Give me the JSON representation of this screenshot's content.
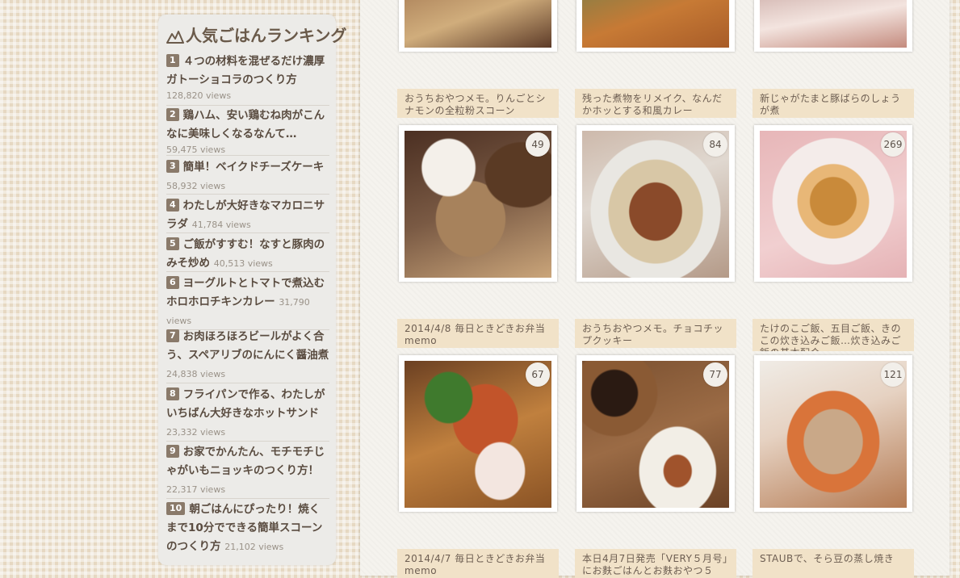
{
  "sidebar": {
    "ranking_title": "人気ごはんランキング",
    "items": [
      {
        "rank": "1",
        "title": "４つの材料を混ぜるだけ濃厚ガトーショコラのつくり方",
        "views": "128,820 views"
      },
      {
        "rank": "2",
        "title": "鶏ハム、安い鶏むね肉がこんなに美味しくなるなんて…",
        "views": "59,475 views"
      },
      {
        "rank": "3",
        "title": "簡単！ベイクドチーズケーキ",
        "views": "58,932 views"
      },
      {
        "rank": "4",
        "title": "わたしが大好きなマカロニサラダ",
        "views": "41,784 views"
      },
      {
        "rank": "5",
        "title": "ご飯がすすむ！なすと豚肉のみそ炒め",
        "views": "40,513 views"
      },
      {
        "rank": "6",
        "title": "ヨーグルトとトマトで煮込むホロホロチキンカレー",
        "views": "31,790 views"
      },
      {
        "rank": "7",
        "title": "お肉ほろほろビールがよく合う、スペアリブのにんにく醤油煮",
        "views": "24,838 views"
      },
      {
        "rank": "8",
        "title": "フライパンで作る、わたしがいちばん大好きなホットサンド",
        "views": "23,332 views"
      },
      {
        "rank": "9",
        "title": "お家でかんたん、モチモチじゃがいもニョッキのつくり方！",
        "views": "22,317 views"
      },
      {
        "rank": "10",
        "title": "朝ごはんにぴったり！焼くまで10分でできる簡単スコーンのつくり方",
        "views": "21,102 views"
      }
    ]
  },
  "posts": {
    "row2": [
      {
        "title": "おうちおやつメモ。りんごとシナモンの全粒粉スコーン",
        "comments": "49"
      },
      {
        "title": "残った煮物をリメイク、なんだかホッとする和風カレー",
        "comments": "84"
      },
      {
        "title": "新じゃがたまと豚ばらのしょうが煮",
        "comments": "269"
      }
    ],
    "row3": [
      {
        "title": "2014/4/8 毎日ときどきお弁当memo",
        "comments": "67"
      },
      {
        "title": "おうちおやつメモ。チョコチップクッキー",
        "comments": "77"
      },
      {
        "title": "たけのこご飯、五目ご飯、きのこの炊き込みご飯…炊き込みご飯の基本配合",
        "comments": "121"
      }
    ],
    "row4": [
      {
        "title": "2014/4/7 毎日ときどきお弁当memo"
      },
      {
        "title": "本日4月7日発売「VERY５月号」にお麩ごはんとお麩おやつ５"
      },
      {
        "title": "STAUBで、そら豆の蒸し焼き"
      }
    ]
  }
}
